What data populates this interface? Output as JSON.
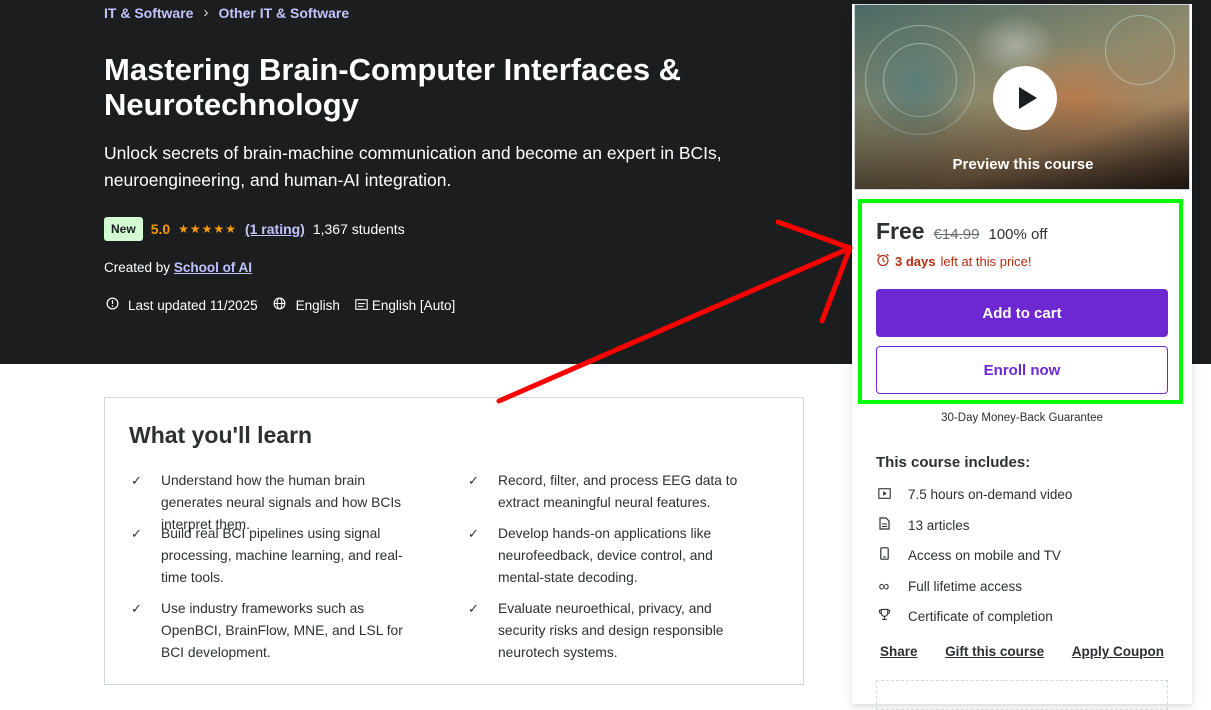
{
  "breadcrumb": [
    "IT & Software",
    "Other IT & Software"
  ],
  "breadcrumb_sep": "›",
  "course": {
    "title": "Mastering Brain-Computer Interfaces & Neurotechnology",
    "subtitle": "Unlock secrets of brain-machine communication and become an expert in BCIs, neuroengineering, and human-AI integration.",
    "badge": "New",
    "rating": "5.0",
    "stars": "★★★★★",
    "rating_count": "(1 rating)",
    "students": "1,367 students",
    "created_by_label": "Created by",
    "author": "School of AI",
    "last_updated": "Last updated 11/2025",
    "language": "English",
    "captions": "English [Auto]"
  },
  "learn": {
    "title": "What you'll learn",
    "items": [
      "Understand how the human brain generates neural signals and how BCIs interpret them.",
      "Record, filter, and process EEG data to extract meaningful neural features.",
      "Build real BCI pipelines using signal processing, machine learning, and real-time tools.",
      "Develop hands-on applications like neurofeedback, device control, and mental-state decoding.",
      "Use industry frameworks such as OpenBCI, BrainFlow, MNE, and LSL for BCI development.",
      "Evaluate neuroethical, privacy, and security risks and design responsible neurotech systems."
    ]
  },
  "sidebar": {
    "preview_label": "Preview this course",
    "price": "Free",
    "original_price": "€14.99",
    "discount": "100% off",
    "timer_bold": "3 days",
    "timer_rest": "left at this price!",
    "add_to_cart": "Add to cart",
    "enroll_now": "Enroll now",
    "guarantee": "30-Day Money-Back Guarantee",
    "includes_title": "This course includes:",
    "includes": [
      {
        "icon": "video-icon",
        "text": "7.5 hours on-demand video"
      },
      {
        "icon": "article-icon",
        "text": "13 articles"
      },
      {
        "icon": "mobile-icon",
        "text": "Access on mobile and TV"
      },
      {
        "icon": "infinity-icon",
        "text": "Full lifetime access"
      },
      {
        "icon": "trophy-icon",
        "text": "Certificate of completion"
      }
    ],
    "links": [
      "Share",
      "Gift this course",
      "Apply Coupon"
    ]
  },
  "colors": {
    "hero_bg": "#1c1d1f",
    "accent": "#6d28d2",
    "highlight": "#00ff00",
    "annotation_arrow": "#ff0000",
    "star": "#f69c08"
  }
}
